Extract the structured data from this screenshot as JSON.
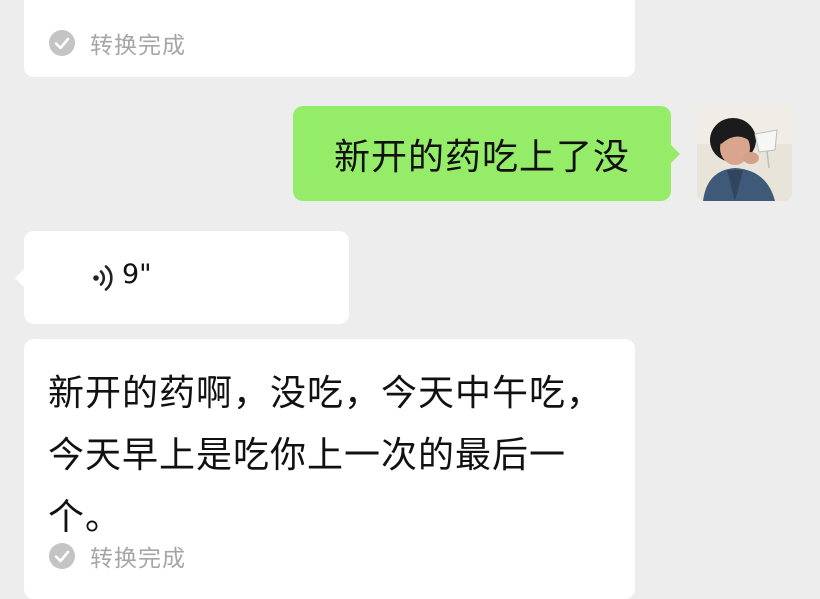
{
  "messages": {
    "top_transcription": {
      "partial_text": "... ... ...",
      "status": "转换完成"
    },
    "sent": {
      "text": "新开的药吃上了没"
    },
    "voice": {
      "duration": "9\""
    },
    "transcription": {
      "text": "新开的药啊，没吃，今天中午吃，今天早上是吃你上一次的最后一个。",
      "status": "转换完成"
    }
  },
  "colors": {
    "background": "#ededed",
    "sent_bubble": "#95ec69",
    "received_bubble": "#ffffff",
    "status_text": "#a6a6a6"
  },
  "icons": [
    "check-circle-icon",
    "voice-wave-icon"
  ]
}
